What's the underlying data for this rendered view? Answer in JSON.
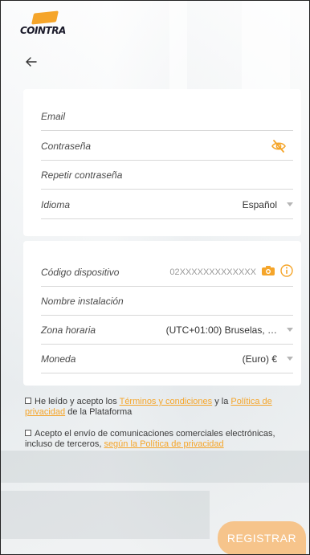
{
  "brand": {
    "name": "COINTRA",
    "accent_color": "#f5a52a",
    "text_color": "#1b1b2b"
  },
  "nav": {
    "back_icon": "arrow-left-icon"
  },
  "account_form": {
    "email": {
      "label": "Email"
    },
    "password": {
      "label": "Contraseña",
      "icon": "eye-slash-icon"
    },
    "repeat_password": {
      "label": "Repetir contraseña"
    },
    "language": {
      "label": "Idioma",
      "value": "Español"
    }
  },
  "installation_form": {
    "device_code": {
      "label": "Código dispositivo",
      "placeholder": "02XXXXXXXXXXXXX",
      "camera_icon": "camera-icon",
      "info_icon": "info-icon"
    },
    "installation_name": {
      "label": "Nombre instalación"
    },
    "timezone": {
      "label": "Zona horaria",
      "value": "(UTC+01:00) Bruselas, …"
    },
    "currency": {
      "label": "Moneda",
      "value": "(Euro) €"
    }
  },
  "legal": {
    "terms": {
      "prefix": "He leído y acepto los ",
      "terms_link": "Términos y condiciones",
      "middle": " y la ",
      "privacy_link": "Política de privacidad",
      "suffix": " de la Plataforma"
    },
    "marketing": {
      "prefix": "Acepto el envío de comunicaciones comerciales electrónicas, incluso de terceros, ",
      "privacy_link": "según la Política de privacidad"
    }
  },
  "actions": {
    "register_label": "REGISTRAR"
  }
}
